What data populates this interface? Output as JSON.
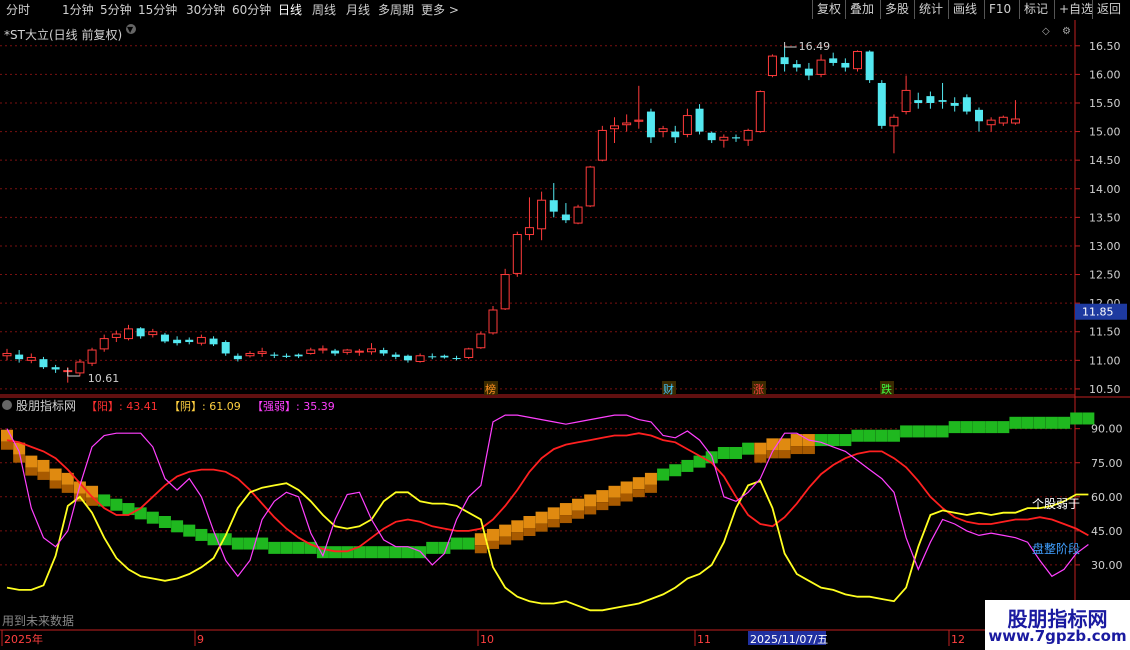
{
  "toolbar": {
    "left": [
      "分时",
      "1分钟",
      "5分钟",
      "15分钟",
      "30分钟",
      "60分钟",
      "日线",
      "周线",
      "月线",
      "多周期",
      "更多 >"
    ],
    "active": "日线",
    "right": [
      "复权",
      "叠加",
      "多股",
      "统计",
      "画线",
      "F10",
      "标记",
      "+自选",
      "返回"
    ]
  },
  "main_title": "*ST大立(日线 前复权)",
  "indicator_title": "股朋指标网",
  "indicator_values": [
    {
      "label": "【阳】",
      "value": "43.41",
      "color": "#ff3030"
    },
    {
      "label": "【阴】",
      "value": "61.09",
      "color": "#ffd040"
    },
    {
      "label": "【强弱】",
      "value": "35.39",
      "color": "#ff40ff"
    }
  ],
  "bottom_left_note": "用到未来数据",
  "date_axis": {
    "labels": [
      "2025年",
      "9",
      "10",
      "11",
      "12"
    ],
    "highlight": "2025/11/07/五"
  },
  "last_price_tag": "11.85",
  "logo": {
    "line1": "股朋指标网",
    "line2": "www.7gpzb.com"
  },
  "colors": {
    "up": "#ff3b3b",
    "down": "#54e8f0",
    "grid": "#7a1010",
    "axis": "#c02020"
  },
  "chart_data": [
    {
      "type": "candlestick",
      "title": "*ST大立(日线 前复权)",
      "ylim": [
        10.35,
        16.75
      ],
      "y_ticks": [
        10.5,
        11.0,
        11.5,
        12.0,
        12.5,
        13.0,
        13.5,
        14.0,
        14.5,
        15.0,
        15.5,
        16.0,
        16.5
      ],
      "annotations": [
        {
          "text": "16.49",
          "date": "2025-11-07"
        },
        {
          "text": "10.61",
          "date": "2025-08-22"
        }
      ],
      "event_labels": [
        {
          "text": "榜",
          "color": "#ff9020"
        },
        {
          "text": "财",
          "color": "#40c8ff"
        },
        {
          "text": "涨",
          "color": "#ff4040"
        },
        {
          "text": "跌",
          "color": "#40ff40"
        }
      ],
      "candles": [
        {
          "o": 11.08,
          "h": 11.2,
          "l": 11.0,
          "c": 11.12
        },
        {
          "o": 11.1,
          "h": 11.18,
          "l": 10.96,
          "c": 11.02
        },
        {
          "o": 11.0,
          "h": 11.12,
          "l": 10.95,
          "c": 11.05
        },
        {
          "o": 11.02,
          "h": 11.06,
          "l": 10.85,
          "c": 10.88
        },
        {
          "o": 10.88,
          "h": 10.92,
          "l": 10.78,
          "c": 10.84
        },
        {
          "o": 10.82,
          "h": 10.88,
          "l": 10.61,
          "c": 10.82
        },
        {
          "o": 10.78,
          "h": 11.02,
          "l": 10.72,
          "c": 10.97
        },
        {
          "o": 10.95,
          "h": 11.22,
          "l": 10.9,
          "c": 11.18
        },
        {
          "o": 11.2,
          "h": 11.45,
          "l": 11.15,
          "c": 11.38
        },
        {
          "o": 11.4,
          "h": 11.52,
          "l": 11.32,
          "c": 11.46
        },
        {
          "o": 11.38,
          "h": 11.62,
          "l": 11.35,
          "c": 11.55
        },
        {
          "o": 11.56,
          "h": 11.58,
          "l": 11.38,
          "c": 11.42
        },
        {
          "o": 11.45,
          "h": 11.55,
          "l": 11.4,
          "c": 11.5
        },
        {
          "o": 11.45,
          "h": 11.48,
          "l": 11.3,
          "c": 11.33
        },
        {
          "o": 11.36,
          "h": 11.42,
          "l": 11.26,
          "c": 11.3
        },
        {
          "o": 11.36,
          "h": 11.4,
          "l": 11.28,
          "c": 11.32
        },
        {
          "o": 11.3,
          "h": 11.45,
          "l": 11.26,
          "c": 11.4
        },
        {
          "o": 11.38,
          "h": 11.42,
          "l": 11.25,
          "c": 11.28
        },
        {
          "o": 11.32,
          "h": 11.35,
          "l": 11.08,
          "c": 11.12
        },
        {
          "o": 11.08,
          "h": 11.12,
          "l": 10.98,
          "c": 11.02
        },
        {
          "o": 11.08,
          "h": 11.16,
          "l": 11.05,
          "c": 11.12
        },
        {
          "o": 11.12,
          "h": 11.22,
          "l": 11.06,
          "c": 11.15
        },
        {
          "o": 11.1,
          "h": 11.14,
          "l": 11.04,
          "c": 11.08
        },
        {
          "o": 11.08,
          "h": 11.12,
          "l": 11.04,
          "c": 11.06
        },
        {
          "o": 11.1,
          "h": 11.12,
          "l": 11.04,
          "c": 11.07
        },
        {
          "o": 11.12,
          "h": 11.22,
          "l": 11.1,
          "c": 11.18
        },
        {
          "o": 11.18,
          "h": 11.26,
          "l": 11.12,
          "c": 11.2
        },
        {
          "o": 11.17,
          "h": 11.2,
          "l": 11.08,
          "c": 11.12
        },
        {
          "o": 11.14,
          "h": 11.2,
          "l": 11.1,
          "c": 11.18
        },
        {
          "o": 11.15,
          "h": 11.2,
          "l": 11.08,
          "c": 11.16
        },
        {
          "o": 11.15,
          "h": 11.3,
          "l": 11.1,
          "c": 11.2
        },
        {
          "o": 11.18,
          "h": 11.22,
          "l": 11.08,
          "c": 11.12
        },
        {
          "o": 11.1,
          "h": 11.14,
          "l": 11.02,
          "c": 11.06
        },
        {
          "o": 11.08,
          "h": 11.1,
          "l": 10.96,
          "c": 11.0
        },
        {
          "o": 10.98,
          "h": 11.12,
          "l": 10.96,
          "c": 11.08
        },
        {
          "o": 11.07,
          "h": 11.12,
          "l": 11.02,
          "c": 11.06
        },
        {
          "o": 11.08,
          "h": 11.1,
          "l": 11.03,
          "c": 11.05
        },
        {
          "o": 11.04,
          "h": 11.08,
          "l": 11.0,
          "c": 11.03
        },
        {
          "o": 11.05,
          "h": 11.22,
          "l": 11.02,
          "c": 11.2
        },
        {
          "o": 11.22,
          "h": 11.5,
          "l": 11.2,
          "c": 11.46
        },
        {
          "o": 11.48,
          "h": 11.95,
          "l": 11.45,
          "c": 11.88
        },
        {
          "o": 11.9,
          "h": 12.6,
          "l": 11.88,
          "c": 12.5
        },
        {
          "o": 12.52,
          "h": 13.25,
          "l": 12.46,
          "c": 13.2
        },
        {
          "o": 13.2,
          "h": 13.85,
          "l": 13.1,
          "c": 13.32
        },
        {
          "o": 13.3,
          "h": 13.95,
          "l": 13.1,
          "c": 13.8
        },
        {
          "o": 13.8,
          "h": 14.1,
          "l": 13.5,
          "c": 13.6
        },
        {
          "o": 13.55,
          "h": 13.75,
          "l": 13.4,
          "c": 13.45
        },
        {
          "o": 13.4,
          "h": 13.72,
          "l": 13.38,
          "c": 13.68
        },
        {
          "o": 13.7,
          "h": 14.4,
          "l": 13.68,
          "c": 14.38
        },
        {
          "o": 14.5,
          "h": 15.1,
          "l": 14.48,
          "c": 15.02
        },
        {
          "o": 15.05,
          "h": 15.25,
          "l": 14.8,
          "c": 15.1
        },
        {
          "o": 15.12,
          "h": 15.3,
          "l": 15.0,
          "c": 15.15
        },
        {
          "o": 15.18,
          "h": 15.8,
          "l": 15.05,
          "c": 15.2
        },
        {
          "o": 15.35,
          "h": 15.4,
          "l": 14.8,
          "c": 14.9
        },
        {
          "o": 15.0,
          "h": 15.1,
          "l": 14.9,
          "c": 15.05
        },
        {
          "o": 15.0,
          "h": 15.1,
          "l": 14.8,
          "c": 14.9
        },
        {
          "o": 14.95,
          "h": 15.4,
          "l": 14.9,
          "c": 15.28
        },
        {
          "o": 15.4,
          "h": 15.48,
          "l": 14.95,
          "c": 15.0
        },
        {
          "o": 14.98,
          "h": 15.0,
          "l": 14.8,
          "c": 14.85
        },
        {
          "o": 14.85,
          "h": 14.95,
          "l": 14.72,
          "c": 14.9
        },
        {
          "o": 14.9,
          "h": 14.95,
          "l": 14.82,
          "c": 14.88
        },
        {
          "o": 14.85,
          "h": 15.05,
          "l": 14.75,
          "c": 15.02
        },
        {
          "o": 15.0,
          "h": 15.72,
          "l": 14.98,
          "c": 15.7
        },
        {
          "o": 15.98,
          "h": 16.35,
          "l": 15.95,
          "c": 16.32
        },
        {
          "o": 16.3,
          "h": 16.49,
          "l": 16.05,
          "c": 16.18
        },
        {
          "o": 16.18,
          "h": 16.25,
          "l": 16.05,
          "c": 16.12
        },
        {
          "o": 16.1,
          "h": 16.2,
          "l": 15.9,
          "c": 15.98
        },
        {
          "o": 16.0,
          "h": 16.35,
          "l": 15.95,
          "c": 16.25
        },
        {
          "o": 16.28,
          "h": 16.38,
          "l": 16.15,
          "c": 16.2
        },
        {
          "o": 16.2,
          "h": 16.28,
          "l": 16.05,
          "c": 16.12
        },
        {
          "o": 16.1,
          "h": 16.42,
          "l": 16.05,
          "c": 16.4
        },
        {
          "o": 16.4,
          "h": 16.42,
          "l": 15.85,
          "c": 15.9
        },
        {
          "o": 15.85,
          "h": 15.9,
          "l": 15.05,
          "c": 15.1
        },
        {
          "o": 15.1,
          "h": 15.3,
          "l": 14.62,
          "c": 15.25
        },
        {
          "o": 15.35,
          "h": 15.98,
          "l": 15.3,
          "c": 15.72
        },
        {
          "o": 15.55,
          "h": 15.68,
          "l": 15.4,
          "c": 15.5
        },
        {
          "o": 15.62,
          "h": 15.7,
          "l": 15.4,
          "c": 15.5
        },
        {
          "o": 15.55,
          "h": 15.85,
          "l": 15.4,
          "c": 15.52
        },
        {
          "o": 15.5,
          "h": 15.6,
          "l": 15.35,
          "c": 15.45
        },
        {
          "o": 15.6,
          "h": 15.65,
          "l": 15.3,
          "c": 15.35
        },
        {
          "o": 15.38,
          "h": 15.42,
          "l": 15.0,
          "c": 15.18
        },
        {
          "o": 15.12,
          "h": 15.25,
          "l": 15.0,
          "c": 15.2
        },
        {
          "o": 15.15,
          "h": 15.28,
          "l": 15.1,
          "c": 15.25
        },
        {
          "o": 15.15,
          "h": 15.55,
          "l": 15.12,
          "c": 15.22
        }
      ]
    },
    {
      "type": "line",
      "title": "股朋指标网",
      "ylim": [
        20,
        100
      ],
      "y_ticks": [
        30,
        45,
        60,
        75,
        90
      ],
      "end_labels": [
        {
          "text": "个股弱于",
          "color": "#ffffff"
        },
        {
          "text": "盘整阶段",
          "color": "#40a0ff"
        }
      ],
      "series": [
        {
          "name": "阳",
          "color": "#ff2020",
          "values": [
            85,
            84,
            82,
            80,
            77,
            72,
            66,
            60,
            55,
            52,
            52,
            55,
            60,
            65,
            69,
            71,
            72,
            72,
            71,
            68,
            63,
            57,
            51,
            46,
            42,
            39,
            37,
            36,
            36,
            38,
            42,
            46,
            49,
            50,
            49,
            47,
            46,
            45,
            45,
            46,
            50,
            56,
            63,
            71,
            77,
            81,
            83,
            84,
            85,
            86,
            87,
            87,
            88,
            87,
            85,
            84,
            81,
            78,
            75,
            69,
            60,
            52,
            48,
            47,
            51,
            57,
            64,
            70,
            74,
            77,
            79,
            80,
            80,
            77,
            73,
            67,
            60,
            55,
            51,
            49,
            48,
            48,
            49,
            50,
            50,
            51,
            50,
            48,
            46,
            43
          ]
        },
        {
          "name": "阴",
          "color": "#ffff20",
          "values": [
            20,
            19,
            19,
            21,
            34,
            56,
            60,
            53,
            42,
            33,
            28,
            25,
            24,
            23,
            24,
            26,
            29,
            33,
            43,
            55,
            62,
            64,
            65,
            66,
            63,
            58,
            52,
            47,
            46,
            47,
            50,
            58,
            62,
            62,
            58,
            57,
            57,
            56,
            53,
            50,
            29,
            20,
            16,
            14,
            13,
            13,
            14,
            12,
            10,
            10,
            11,
            12,
            13,
            15,
            17,
            20,
            24,
            26,
            30,
            40,
            55,
            65,
            67,
            55,
            35,
            26,
            23,
            20,
            19,
            17,
            16,
            16,
            15,
            14,
            20,
            38,
            52,
            54,
            53,
            52,
            53,
            52,
            53,
            53,
            55,
            55,
            56,
            58,
            61,
            61
          ]
        },
        {
          "name": "强弱",
          "color": "#ff40ff",
          "values": [
            90,
            80,
            55,
            42,
            38,
            45,
            65,
            82,
            87,
            88,
            88,
            88,
            82,
            68,
            63,
            68,
            60,
            45,
            32,
            25,
            32,
            50,
            58,
            62,
            60,
            44,
            34,
            50,
            61,
            62,
            50,
            41,
            38,
            38,
            36,
            30,
            35,
            50,
            60,
            65,
            93,
            96,
            96,
            95,
            94,
            93,
            92,
            93,
            94,
            95,
            96,
            96,
            94,
            93,
            87,
            86,
            89,
            85,
            78,
            60,
            58,
            62,
            68,
            80,
            88,
            88,
            85,
            84,
            82,
            80,
            76,
            72,
            68,
            62,
            42,
            28,
            40,
            50,
            48,
            45,
            43,
            44,
            43,
            42,
            40,
            32,
            25,
            28,
            35,
            39
          ]
        },
        {
          "name": "堆叠",
          "color": "#22cc22",
          "values": [
            31,
            28,
            25,
            24,
            22,
            21,
            19,
            18,
            16,
            15,
            14,
            13,
            12,
            11,
            10,
            9,
            8,
            7,
            7,
            6,
            6,
            6,
            5,
            5,
            5,
            5,
            4,
            4,
            4,
            4,
            4,
            4,
            4,
            4,
            4,
            5,
            5,
            6,
            6,
            7,
            8,
            9,
            10,
            11,
            12,
            13,
            14,
            15,
            16,
            17,
            18,
            19,
            20,
            21,
            22,
            23,
            24,
            25,
            26,
            27,
            27,
            28,
            28,
            29,
            29,
            30,
            30,
            30,
            30,
            30,
            31,
            31,
            31,
            31,
            32,
            32,
            32,
            32,
            33,
            33,
            33,
            33,
            33,
            34,
            34,
            34,
            34,
            34,
            35,
            35
          ]
        }
      ]
    }
  ]
}
